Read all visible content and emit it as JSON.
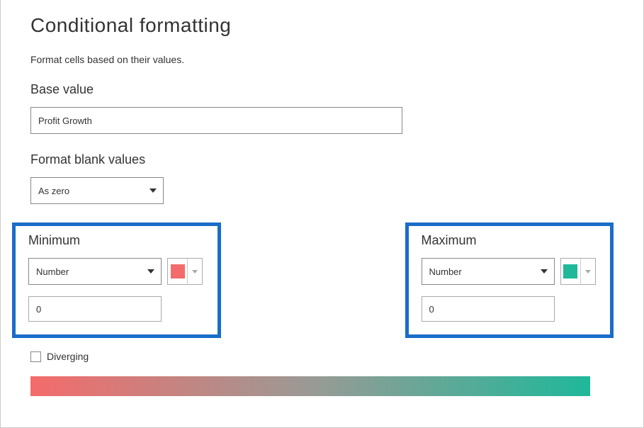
{
  "title": "Conditional formatting",
  "subtitle": "Format cells based on their values.",
  "baseValue": {
    "label": "Base value",
    "value": "Profit Growth"
  },
  "formatBlank": {
    "label": "Format blank values",
    "value": "As zero"
  },
  "minimum": {
    "label": "Minimum",
    "type": "Number",
    "value": "0",
    "color": "#f46b6b"
  },
  "maximum": {
    "label": "Maximum",
    "type": "Number",
    "value": "0",
    "color": "#1fb89a"
  },
  "diverging": {
    "label": "Diverging",
    "checked": false
  },
  "gradient": {
    "from": "#f46b6b",
    "mid": "#9a9a95",
    "to": "#1fb89a"
  }
}
